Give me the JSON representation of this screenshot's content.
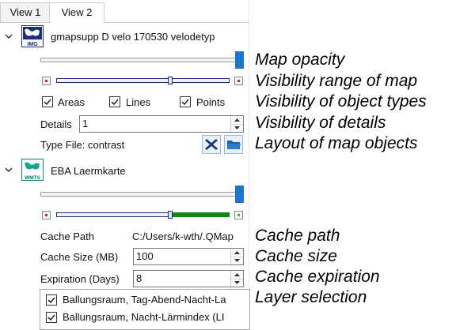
{
  "tabs": [
    {
      "label": "View 1"
    },
    {
      "label": "View 2"
    }
  ],
  "map1": {
    "title": "gmapsupp D velo 170530 velodetyp",
    "icon_label": "IMG",
    "areas_label": "Areas",
    "lines_label": "Lines",
    "points_label": "Points",
    "details_label": "Details",
    "details_value": "1",
    "typefile_label": "Type File: contrast",
    "opacity": 1.0
  },
  "map2": {
    "title": "EBA Laermkarte",
    "icon_label": "WMTS",
    "cache_path_label": "Cache Path",
    "cache_path_value": "C:/Users/k-wth/.QMap",
    "cache_size_label": "Cache Size (MB)",
    "cache_size_value": "100",
    "expiration_label": "Expiration (Days)",
    "expiration_value": "8",
    "layers": [
      {
        "label": "Ballungsraum, Tag-Abend-Nacht-La",
        "checked": true
      },
      {
        "label": "Ballungsraum, Nacht-Lärmindex (LI",
        "checked": true
      }
    ],
    "opacity": 1.0
  },
  "annotations": {
    "map_opacity": "Map opacity",
    "visibility_range": "Visibility range of map",
    "visibility_types": "Visibility of object types",
    "visibility_details": "Visibility of details",
    "layout_objects": "Layout of map objects",
    "cache_path": "Cache path",
    "cache_size": "Cache size",
    "cache_expiration": "Cache expiration",
    "layer_selection": "Layer selection"
  },
  "colors": {
    "accent": "#1976d2",
    "range_green": "#0a8a0a",
    "delete_icon": "#1a3a6b",
    "folder_icon": "#1d5fb0"
  }
}
